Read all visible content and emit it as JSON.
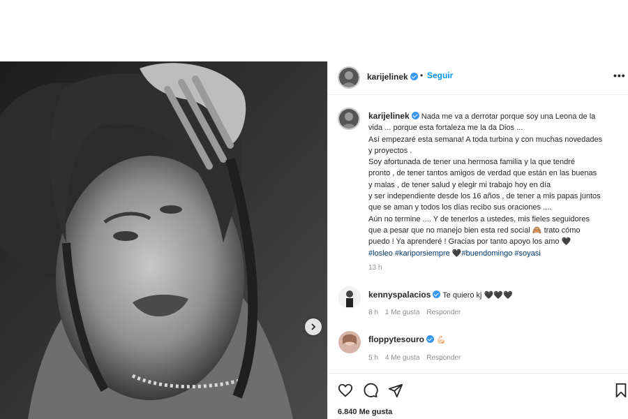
{
  "post": {
    "username": "karijelinek",
    "follow_label": "Seguir",
    "separator": "•",
    "more_label": "•••",
    "caption_lines": [
      "Nada me va a derrotar porque soy una Leona de la",
      "vida ... porque esta fortaleza me la da Dios ...",
      "Así empezaré esta semana! A toda turbina y con muchas novedades",
      "y proyectos .",
      "Soy afortunada de tener una hermosa familia y la que tendré",
      "pronto , de tener tantos amigos de verdad que están en las buenas",
      "y malas , de tener salud y elegir mi trabajo hoy en día",
      "y ser independiente desde los 16 años , de tener a mis papas juntos",
      "que se aman y todos los días recibo sus oraciones ....",
      "Aún no termine .... Y de tenerlos a ustedes, mis fieles seguidores",
      "que a pesar que no manejo bien esta red social 🙈 trato cómo",
      "puedo ! Ya aprenderé ! Gracias por tanto apoyo los amo 🖤"
    ],
    "hashtags": "#losleo #kariporsiempre 🖤#buendomingo #soyasi",
    "time": "13 h",
    "likes": "6.840 Me gusta"
  },
  "comments": [
    {
      "username": "kennyspalacios",
      "text": "Te quiero kj 🖤🖤🖤",
      "time": "8 h",
      "likes": "1 Me gusta",
      "reply": "Responder"
    },
    {
      "username": "floppytesouro",
      "text": "💪🏻",
      "time": "5 h",
      "likes": "4 Me gusta",
      "reply": "Responder"
    }
  ],
  "icons": {
    "carousel_next": "chevron-right-icon",
    "like": "heart-icon",
    "comment": "comment-icon",
    "share": "paper-plane-icon",
    "save": "bookmark-icon"
  },
  "colors": {
    "accent": "#0095f6",
    "verified": "#3897f0",
    "hashtag": "#00376b",
    "muted": "#8e8e8e"
  }
}
